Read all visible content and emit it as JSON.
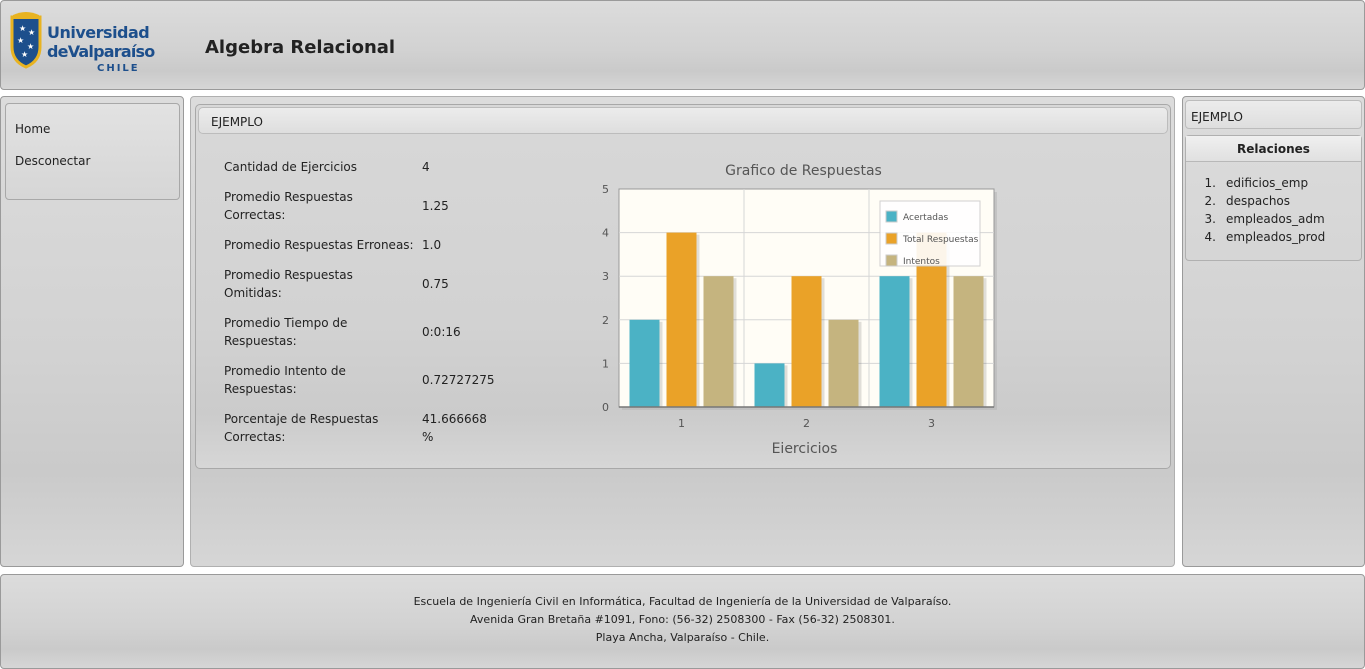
{
  "header": {
    "logo": {
      "line1": "Universidad",
      "line2": "deValparaíso",
      "line3": "CHILE"
    },
    "app_title": "Algebra Relacional"
  },
  "left_nav": {
    "items": [
      {
        "label": "Home"
      },
      {
        "label": "Desconectar"
      }
    ]
  },
  "main": {
    "box_title": "EJEMPLO",
    "stats": [
      {
        "label": "Cantidad de Ejercicios",
        "value": "4"
      },
      {
        "label": "Promedio Respuestas Correctas:",
        "value": "1.25"
      },
      {
        "label": "Promedio Respuestas Erroneas:",
        "value": "1.0"
      },
      {
        "label": "Promedio Respuestas Omitidas:",
        "value": "0.75"
      },
      {
        "label": "Promedio Tiempo de Respuestas:",
        "value": "0:0:16"
      },
      {
        "label": "Promedio Intento de Respuestas:",
        "value": "0.72727275"
      },
      {
        "label": "Porcentaje de Respuestas Correctas:",
        "value": "41.666668 %"
      }
    ]
  },
  "chart_data": {
    "type": "bar",
    "title": "Grafico de Respuestas",
    "xlabel": "Ejercicios",
    "ylabel": "",
    "categories": [
      "1",
      "2",
      "3"
    ],
    "ylim": [
      0,
      5
    ],
    "yticks": [
      "0",
      "1",
      "2",
      "3",
      "4",
      "5"
    ],
    "grid": true,
    "legend": "top-right",
    "series": [
      {
        "name": "Acertadas",
        "values": [
          2,
          1,
          3
        ],
        "color": "#4bb2c5"
      },
      {
        "name": "Total Respuestas",
        "values": [
          4,
          3,
          4
        ],
        "color": "#eaa228"
      },
      {
        "name": "Intentos",
        "values": [
          3,
          2,
          3
        ],
        "color": "#c5b47f"
      }
    ]
  },
  "right_nav": {
    "title": "EJEMPLO",
    "panel_title": "Relaciones",
    "relations": [
      {
        "num": "1.",
        "name": "edificios_emp"
      },
      {
        "num": "2.",
        "name": "despachos"
      },
      {
        "num": "3.",
        "name": "empleados_adm"
      },
      {
        "num": "4.",
        "name": "empleados_prod"
      }
    ]
  },
  "footer": {
    "line1": "Escuela de Ingeniería Civil en Informática, Facultad de Ingeniería de la Universidad de Valparaíso.",
    "line2": "Avenida Gran Bretaña #1091, Fono: (56-32) 2508300 - Fax (56-32) 2508301.",
    "line3": "Playa Ancha, Valparaíso - Chile."
  },
  "colors": {
    "brand_blue": "#1d4f8c",
    "brand_gold": "#e8b321",
    "chart_background": "#fffdf6"
  }
}
